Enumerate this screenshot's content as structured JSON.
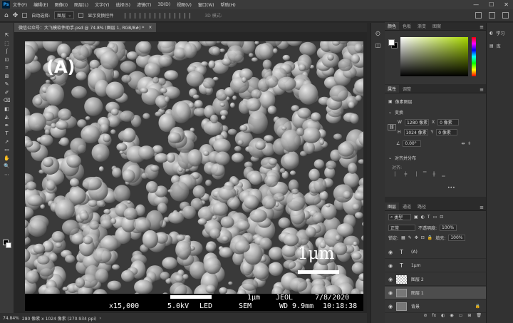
{
  "app": {
    "logo": "Ps"
  },
  "menu": [
    "文件(F)",
    "编辑(E)",
    "图像(I)",
    "图层(L)",
    "文字(Y)",
    "选择(S)",
    "滤镜(T)",
    "3D(D)",
    "视图(V)",
    "窗口(W)",
    "帮助(H)"
  ],
  "window_controls": {
    "minimize": "—",
    "maximize": "☐",
    "close": "✕"
  },
  "options": {
    "auto_select_label": "自动选择:",
    "auto_select_value": "图层",
    "show_transform_label": "显示变换控件",
    "mode_3d_label": "3D 模式:"
  },
  "document_tab": {
    "title": "微信公众号：大飞模软件助手.psd @ 74.8% (图层 1, RGB/8#) *",
    "close": "×"
  },
  "tools": [
    "⇱",
    "⬚",
    "ʃ",
    "⊡",
    "⌗",
    "⊠",
    "✎",
    "✐",
    "⌫",
    "◧",
    "◭",
    "✒",
    "T",
    "➚",
    "▭",
    "✋",
    "🔍",
    "⋯"
  ],
  "image": {
    "panel_label": "(A)",
    "scale_label": "1μm",
    "sem_info": {
      "magnification": "x15,000",
      "scale": "1μm",
      "voltage": "5.0kV",
      "detector": "LED",
      "maker": "JEOL",
      "mode": "SEM",
      "wd": "WD 9.9mm",
      "date": "7/8/2020",
      "time": "10:18:38"
    }
  },
  "status": {
    "zoom": "74.84%",
    "doc_info": "280 像素 x 1024 像素 (270.934 ppi)",
    "arrow": "›"
  },
  "color_panel": {
    "tabs": [
      "颜色",
      "色板",
      "渐变",
      "图案"
    ],
    "fg_color": "#ffffff",
    "bg_color": "#000000",
    "picker_hue": "#a8d800"
  },
  "properties_panel": {
    "tabs": [
      "属性",
      "调整"
    ],
    "kind": "像素图层",
    "transform_title": "变换",
    "w_label": "W",
    "w_value": "1280 像素",
    "h_label": "H",
    "h_value": "1024 像素",
    "x_label": "X",
    "x_value": "0 像素",
    "y_label": "Y",
    "y_value": "0 像素",
    "angle_value": "0.00°",
    "align_title": "对齐并分布",
    "align_label": "对齐:",
    "more": "•••"
  },
  "layers_panel": {
    "tabs": [
      "图层",
      "通道",
      "路径"
    ],
    "kind_label": "类型",
    "blend_mode": "正常",
    "opacity_label": "不透明度:",
    "opacity_value": "100%",
    "lock_label": "锁定:",
    "fill_label": "填充:",
    "fill_value": "100%",
    "layers": [
      {
        "name": "(A)",
        "type": "T"
      },
      {
        "name": "1μm",
        "type": "T"
      },
      {
        "name": "图层 2",
        "type": "trans"
      },
      {
        "name": "图层 1",
        "type": "img",
        "selected": true
      },
      {
        "name": "背景",
        "type": "img",
        "locked": true
      }
    ],
    "footer": [
      "⊘",
      "fx",
      "◐",
      "◉",
      "▭",
      "⊞",
      "🗑"
    ]
  },
  "side_items": [
    {
      "icon": "◐",
      "label": "学习"
    },
    {
      "icon": "▤",
      "label": "库"
    }
  ]
}
